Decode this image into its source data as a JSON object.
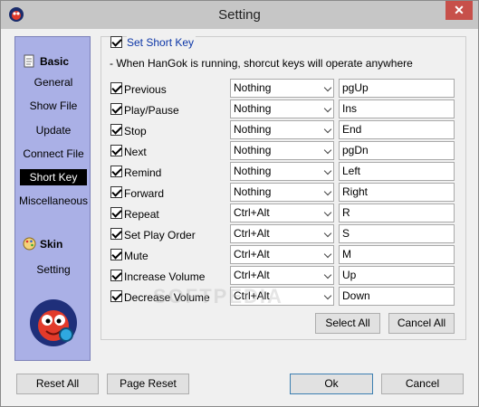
{
  "window": {
    "title": "Setting",
    "close_label": "✕"
  },
  "sidebar": {
    "basic_header": "Basic",
    "items": [
      {
        "label": "General",
        "active": false
      },
      {
        "label": "Show File",
        "active": false
      },
      {
        "label": "Update",
        "active": false
      },
      {
        "label": "Connect File",
        "active": false
      },
      {
        "label": "Short Key",
        "active": true
      },
      {
        "label": "Miscellaneous",
        "active": false
      }
    ],
    "skin_header": "Skin",
    "skin_items": [
      {
        "label": "Setting",
        "active": false
      }
    ]
  },
  "shortkey": {
    "set_short_key_label": "Set Short Key",
    "set_short_key_checked": true,
    "description": "- When HanGok is running, shorcut keys will operate anywhere",
    "rows": [
      {
        "label": "Previous",
        "checked": true,
        "modifier": "Nothing",
        "key": "pgUp"
      },
      {
        "label": "Play/Pause",
        "checked": true,
        "modifier": "Nothing",
        "key": "Ins"
      },
      {
        "label": "Stop",
        "checked": true,
        "modifier": "Nothing",
        "key": "End"
      },
      {
        "label": "Next",
        "checked": true,
        "modifier": "Nothing",
        "key": "pgDn"
      },
      {
        "label": "Remind",
        "checked": true,
        "modifier": "Nothing",
        "key": "Left"
      },
      {
        "label": "Forward",
        "checked": true,
        "modifier": "Nothing",
        "key": "Right"
      },
      {
        "label": "Repeat",
        "checked": true,
        "modifier": "Ctrl+Alt",
        "key": "R"
      },
      {
        "label": "Set Play Order",
        "checked": true,
        "modifier": "Ctrl+Alt",
        "key": "S"
      },
      {
        "label": "Mute",
        "checked": true,
        "modifier": "Ctrl+Alt",
        "key": "M"
      },
      {
        "label": "Increase Volume",
        "checked": true,
        "modifier": "Ctrl+Alt",
        "key": "Up"
      },
      {
        "label": "Decrease Volume",
        "checked": true,
        "modifier": "Ctrl+Alt",
        "key": "Down"
      }
    ],
    "select_all_label": "Select All",
    "cancel_all_label": "Cancel All"
  },
  "footer": {
    "reset_all_label": "Reset All",
    "page_reset_label": "Page Reset",
    "ok_label": "Ok",
    "cancel_label": "Cancel"
  },
  "watermark": "SOFTPEDIA",
  "colors": {
    "sidebar_bg": "#aab0e6",
    "link_blue": "#0c36a7",
    "close_red": "#c7504a"
  }
}
